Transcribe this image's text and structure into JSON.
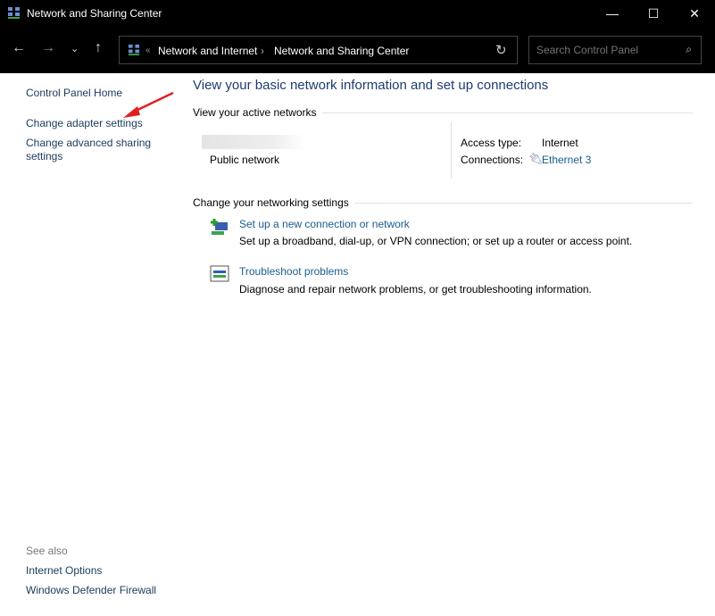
{
  "window": {
    "title": "Network and Sharing Center",
    "app_icon": "network-icon"
  },
  "nav": {
    "breadcrumb": [
      "Network and Internet",
      "Network and Sharing Center"
    ],
    "overflow": "«",
    "search_placeholder": "Search Control Panel"
  },
  "sidebar": {
    "home": "Control Panel Home",
    "items": [
      "Change adapter settings",
      "Change advanced sharing settings"
    ],
    "see_also_label": "See also",
    "see_also": [
      "Internet Options",
      "Windows Defender Firewall"
    ]
  },
  "main": {
    "title": "View your basic network information and set up connections",
    "active_networks_label": "View your active networks",
    "network": {
      "type": "Public network",
      "access_type_label": "Access type:",
      "access_type": "Internet",
      "connections_label": "Connections:",
      "connection": "Ethernet 3"
    },
    "change_label": "Change your networking settings",
    "tasks": [
      {
        "link": "Set up a new connection or network",
        "desc": "Set up a broadband, dial-up, or VPN connection; or set up a router or access point.",
        "icon": "new-connection-icon"
      },
      {
        "link": "Troubleshoot problems",
        "desc": "Diagnose and repair network problems, or get troubleshooting information.",
        "icon": "troubleshoot-icon"
      }
    ]
  },
  "annotation": {
    "arrow_color": "#e02020"
  }
}
